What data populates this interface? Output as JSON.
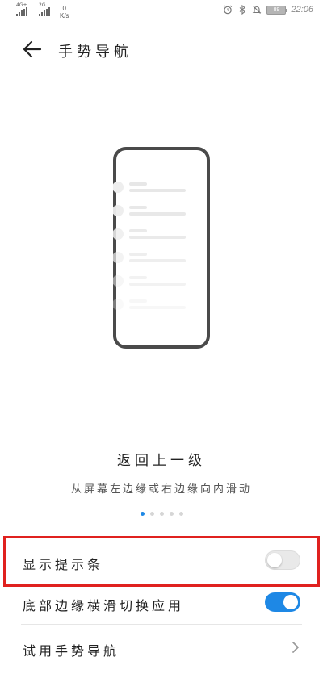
{
  "status_bar": {
    "sim1_tag": "4G+",
    "sim2_tag": "2G",
    "speed_value": "0",
    "speed_unit": "K/s",
    "time": "22:06",
    "battery_label": "89"
  },
  "header": {
    "title": "手势导航"
  },
  "gesture_demo": {
    "title": "返回上一级",
    "description": "从屏幕左边缘或右边缘向内滑动",
    "page_count": 5,
    "active_page": 1
  },
  "settings": {
    "show_hint_bar": {
      "label": "显示提示条",
      "enabled": false
    },
    "bottom_swipe_switch_apps": {
      "label": "底部边缘横滑切换应用",
      "enabled": true
    },
    "try_gesture_nav": {
      "label": "试用手势导航"
    }
  },
  "colors": {
    "accent": "#1e88e5",
    "highlight_box": "#e0211f"
  }
}
